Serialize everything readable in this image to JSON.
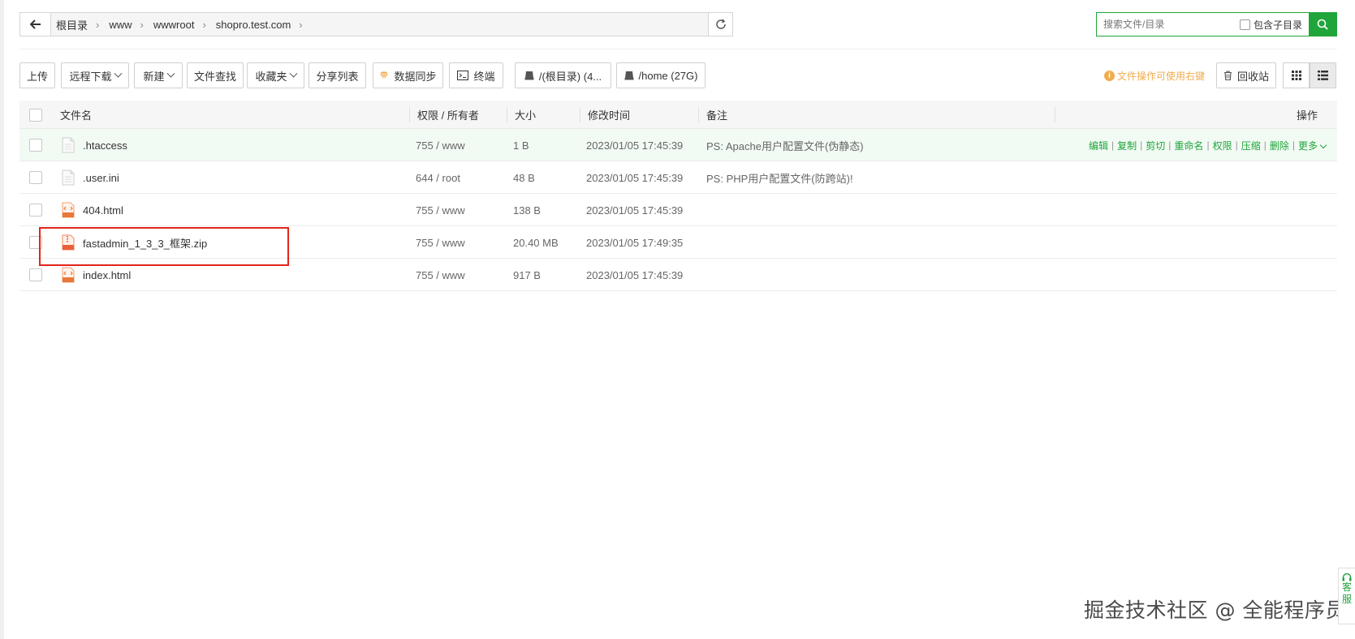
{
  "path": {
    "crumbs": [
      "根目录",
      "www",
      "wwwroot",
      "shopro.test.com"
    ]
  },
  "search": {
    "placeholder": "搜索文件/目录",
    "subdir_label": "包含子目录"
  },
  "toolbar": {
    "upload": "上传",
    "remote_download": "远程下载",
    "new": "新建",
    "file_search": "文件查找",
    "favorites": "收藏夹",
    "share_list": "分享列表",
    "data_sync": "数据同步",
    "terminal": "终端",
    "disk_root": "/(根目录) (4...",
    "disk_home": "/home (27G)",
    "hint": "文件操作可使用右键",
    "recycle_bin": "回收站"
  },
  "table": {
    "headers": {
      "name": "文件名",
      "perm": "权限 / 所有者",
      "size": "大小",
      "mtime": "修改时间",
      "note": "备注",
      "actions": "操作"
    },
    "rows": [
      {
        "name": ".htaccess",
        "perm": "755 / www",
        "size": "1 B",
        "mtime": "2023/01/05 17:45:39",
        "note": "PS: Apache用户配置文件(伪静态)",
        "icon": "text-file-icon"
      },
      {
        "name": ".user.ini",
        "perm": "644 / root",
        "size": "48 B",
        "mtime": "2023/01/05 17:45:39",
        "note": "PS: PHP用户配置文件(防跨站)!",
        "icon": "text-file-icon"
      },
      {
        "name": "404.html",
        "perm": "755 / www",
        "size": "138 B",
        "mtime": "2023/01/05 17:45:39",
        "note": "",
        "icon": "html-file-icon"
      },
      {
        "name": "fastadmin_1_3_3_框架.zip",
        "perm": "755 / www",
        "size": "20.40 MB",
        "mtime": "2023/01/05 17:49:35",
        "note": "",
        "icon": "zip-file-icon"
      },
      {
        "name": "index.html",
        "perm": "755 / www",
        "size": "917 B",
        "mtime": "2023/01/05 17:45:39",
        "note": "",
        "icon": "html-file-icon"
      }
    ],
    "row_actions": [
      "编辑",
      "复制",
      "剪切",
      "重命名",
      "权限",
      "压缩",
      "删除",
      "更多"
    ]
  },
  "watermark": "掘金技术社区 @ 全能程序员",
  "service": [
    "客",
    "服"
  ],
  "colors": {
    "accent": "#20a53a",
    "warning": "#f0ad4e",
    "highlight": "#e1251b"
  }
}
